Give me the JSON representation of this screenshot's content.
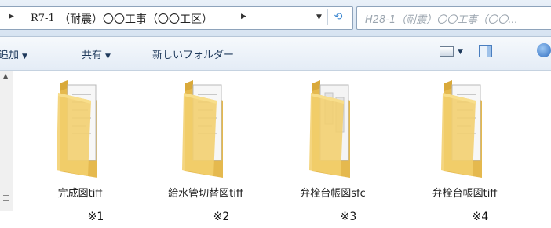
{
  "address_bar": {
    "breadcrumb_primary": "R7-1",
    "breadcrumb_secondary": "（耐震）〇〇工事（〇〇工区）",
    "search_text": "H28-1（耐震）〇〇工事（〇〇..."
  },
  "toolbar": {
    "add_label": "追加",
    "share_label": "共有",
    "new_folder_label": "新しいフォルダー"
  },
  "folders": [
    {
      "name": "完成図tiff",
      "note": "※1",
      "icon": "folder-icon"
    },
    {
      "name": "給水管切替図tiff",
      "note": "※2",
      "icon": "folder-icon"
    },
    {
      "name": "弁栓台帳図sfc",
      "note": "※3",
      "icon": "folder-icon"
    },
    {
      "name": "弁栓台帳図tiff",
      "note": "※4",
      "icon": "folder-icon"
    }
  ]
}
